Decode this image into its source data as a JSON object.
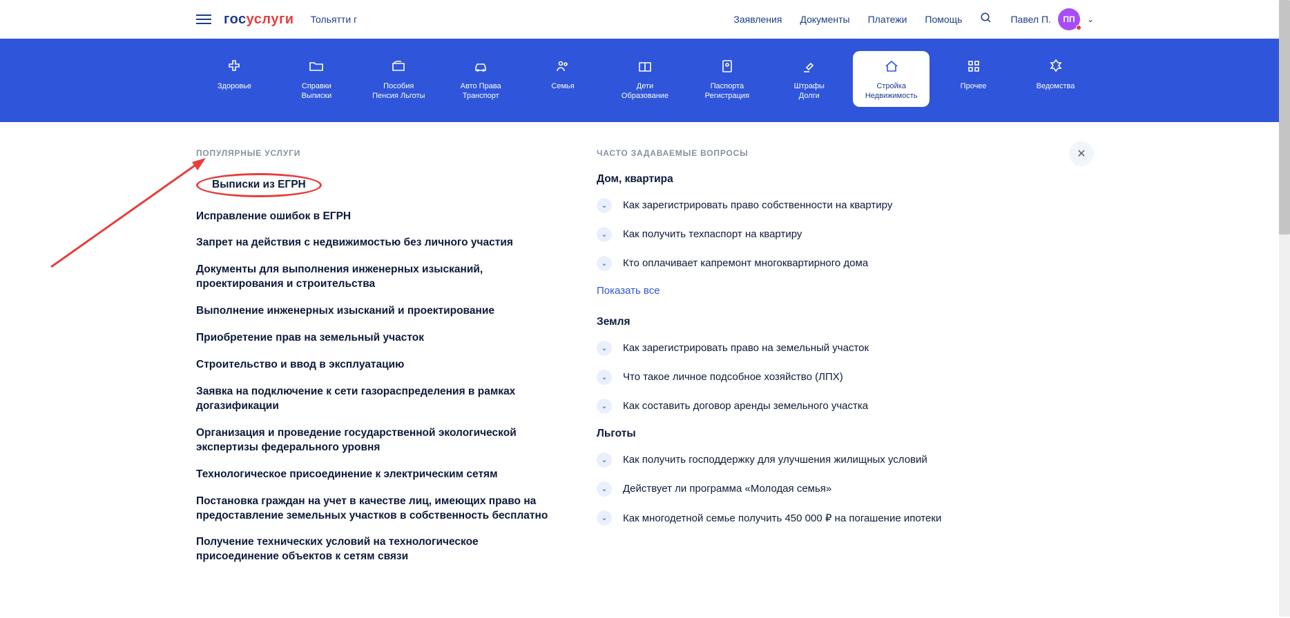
{
  "header": {
    "logo_blue": "гос",
    "logo_red": "услуги",
    "city": "Тольятти г",
    "links": [
      "Заявления",
      "Документы",
      "Платежи",
      "Помощь"
    ],
    "user_name": "Павел П.",
    "avatar_initials": "ПП"
  },
  "nav": [
    {
      "line1": "Здоровье",
      "line2": "",
      "icon": "health"
    },
    {
      "line1": "Справки",
      "line2": "Выписки",
      "icon": "folder"
    },
    {
      "line1": "Пособия",
      "line2": "Пенсия Льготы",
      "icon": "wallet"
    },
    {
      "line1": "Авто Права",
      "line2": "Транспорт",
      "icon": "car"
    },
    {
      "line1": "Семья",
      "line2": "",
      "icon": "family"
    },
    {
      "line1": "Дети",
      "line2": "Образование",
      "icon": "education"
    },
    {
      "line1": "Паспорта",
      "line2": "Регистрация",
      "icon": "passport"
    },
    {
      "line1": "Штрафы",
      "line2": "Долги",
      "icon": "gavel"
    },
    {
      "line1": "Стройка",
      "line2": "Недвижимость",
      "icon": "house"
    },
    {
      "line1": "Прочее",
      "line2": "",
      "icon": "other"
    },
    {
      "line1": "Ведомства",
      "line2": "",
      "icon": "emblem"
    }
  ],
  "nav_active_index": 8,
  "popular": {
    "title": "ПОПУЛЯРНЫЕ УСЛУГИ",
    "items": [
      "Выписки из ЕГРН",
      "Исправление ошибок в ЕГРН",
      "Запрет на действия с недвижимостью без личного участия",
      "Документы для выполнения инженерных изысканий, проектирования и строительства",
      "Выполнение инженерных изысканий и проектирование",
      "Приобретение прав на земельный участок",
      "Строительство и ввод в эксплуатацию",
      "Заявка на подключение к сети газораспределения в рамках догазификации",
      "Организация и проведение государственной экологической экспертизы федерального уровня",
      "Технологическое присоединение к электрическим сетям",
      "Постановка граждан на учет в качестве лиц, имеющих право на предоставление земельных участков в собственность бесплатно",
      "Получение технических условий на технологическое присоединение объектов к сетям связи"
    ]
  },
  "faq": {
    "title": "ЧАСТО ЗАДАВАЕМЫЕ ВОПРОСЫ",
    "show_all_label": "Показать все",
    "groups": [
      {
        "title": "Дом, квартира",
        "items": [
          "Как зарегистрировать право собственности на квартиру",
          "Как получить техпаспорт на квартиру",
          "Кто оплачивает капремонт многоквартирного дома"
        ],
        "has_show_all": true
      },
      {
        "title": "Земля",
        "items": [
          "Как зарегистрировать право на земельный участок",
          "Что такое личное подсобное хозяйство (ЛПХ)",
          "Как составить договор аренды земельного участка"
        ],
        "has_show_all": false
      },
      {
        "title": "Льготы",
        "items": [
          "Как получить господдержку для улучшения жилищных условий",
          "Действует ли программа «Молодая семья»",
          "Как многодетной семье получить 450 000 ₽ на погашение ипотеки"
        ],
        "has_show_all": false
      }
    ]
  }
}
